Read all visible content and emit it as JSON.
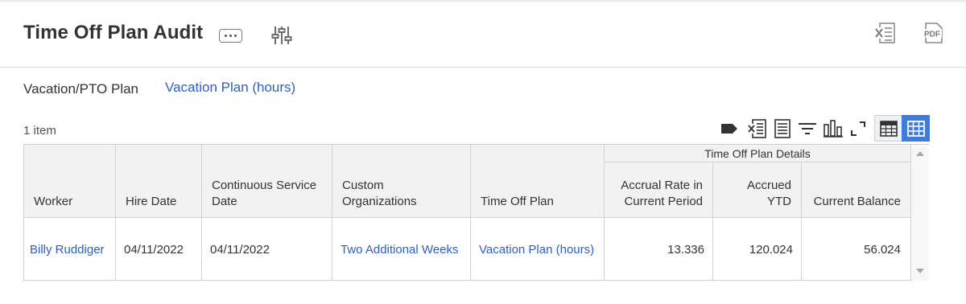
{
  "header": {
    "title": "Time Off Plan Audit",
    "more_icon": "ellipsis-icon",
    "filter_icon": "sliders-icon",
    "excel_icon": "excel-export-icon",
    "pdf_icon": "pdf-export-icon",
    "pdf_label": "PDF"
  },
  "prompt": {
    "label": "Vacation/PTO Plan",
    "value": "Vacation Plan (hours)"
  },
  "grid": {
    "count_label": "1 item",
    "toolbar_icons": [
      "tag-icon",
      "excel-icon",
      "list-view-icon",
      "filter-icon",
      "chart-icon",
      "fullscreen-icon",
      "table-view-icon",
      "grid-view-icon"
    ],
    "group_header": "Time Off Plan Details",
    "columns": [
      "Worker",
      "Hire Date",
      "Continuous Service Date",
      "Custom Organizations",
      "Time Off Plan",
      "Accrual Rate in Current Period",
      "Accrued YTD",
      "Current Balance"
    ],
    "rows": [
      {
        "worker": "Billy Ruddiger",
        "hire_date": "04/11/2022",
        "continuous_service_date": "04/11/2022",
        "custom_organizations": "Two Additional Weeks",
        "time_off_plan": "Vacation Plan (hours)",
        "accrual_rate": "13.336",
        "accrued_ytd": "120.024",
        "current_balance": "56.024"
      }
    ]
  },
  "colors": {
    "link": "#2f5fbd",
    "accent": "#3e7bdc",
    "header_bg": "#f2f2f2"
  }
}
